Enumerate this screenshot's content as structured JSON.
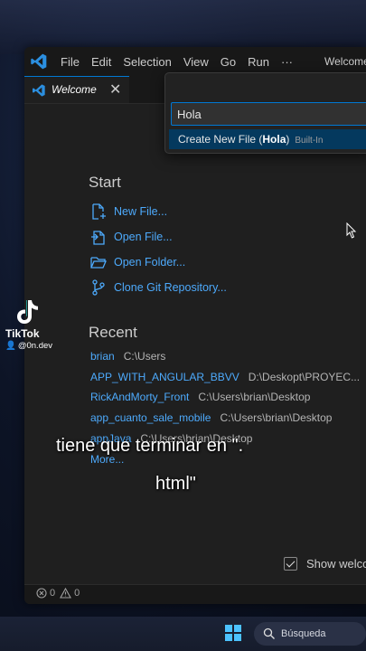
{
  "window": {
    "menu": [
      "File",
      "Edit",
      "Selection",
      "View",
      "Go",
      "Run",
      "···"
    ],
    "title": "Welcome"
  },
  "tab": {
    "label": "Welcome",
    "close": "✕"
  },
  "quick_pick": {
    "input_value": "Hola",
    "option_prefix": "Create New File (",
    "option_bold": "Hola",
    "option_suffix": ")",
    "option_tag": "Built-In"
  },
  "start": {
    "title": "Start",
    "actions": [
      {
        "label": "New File...",
        "icon": "new-file-icon"
      },
      {
        "label": "Open File...",
        "icon": "open-file-icon"
      },
      {
        "label": "Open Folder...",
        "icon": "open-folder-icon"
      },
      {
        "label": "Clone Git Repository...",
        "icon": "git-branch-icon"
      }
    ]
  },
  "recent": {
    "title": "Recent",
    "items": [
      {
        "name": "brian",
        "path": "C:\\Users"
      },
      {
        "name": "APP_WITH_ANGULAR_BBVV",
        "path": "D:\\Deskopt\\PROYEC..."
      },
      {
        "name": "RickAndMorty_Front",
        "path": "C:\\Users\\brian\\Desktop"
      },
      {
        "name": "app_cuanto_sale_mobile",
        "path": "C:\\Users\\brian\\Desktop"
      },
      {
        "name": "appJava",
        "path": "C:\\Users\\brian\\Desktop"
      }
    ],
    "more": "More..."
  },
  "caption": {
    "line1": "tiene que terminar en \".",
    "line2": "html\""
  },
  "show_welcome": {
    "label": "Show welco",
    "checked": true
  },
  "status": {
    "errors": "0",
    "warnings": "0"
  },
  "tiktok": {
    "name": "TikTok",
    "handle": "@0n.dev"
  },
  "taskbar": {
    "search_label": "Búsqueda"
  },
  "colors": {
    "accent": "#0078d4",
    "link": "#4daafc",
    "editor_bg": "#1f1f1f"
  }
}
